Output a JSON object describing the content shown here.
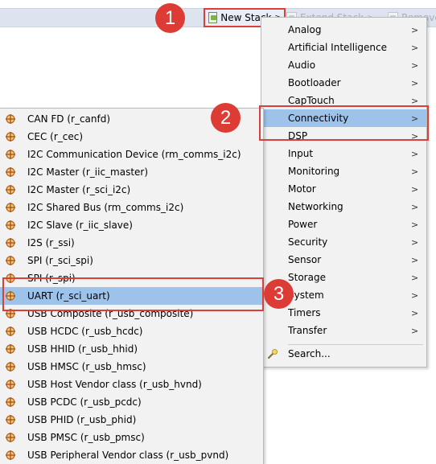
{
  "toolbar": {
    "new_stack_label": "New Stack",
    "new_stack_caret": ">",
    "extend_stack_label": "Extend Stack",
    "extend_stack_caret": ">",
    "remove_label": "Remove"
  },
  "badges": {
    "step1": "1",
    "step2": "2",
    "step3": "3"
  },
  "categories": {
    "items": [
      {
        "label": "Analog",
        "arrow": ">"
      },
      {
        "label": "Artificial Intelligence",
        "arrow": ">"
      },
      {
        "label": "Audio",
        "arrow": ">"
      },
      {
        "label": "Bootloader",
        "arrow": ">"
      },
      {
        "label": "CapTouch",
        "arrow": ">"
      },
      {
        "label": "Connectivity",
        "arrow": ">"
      },
      {
        "label": "DSP",
        "arrow": ">"
      },
      {
        "label": "Input",
        "arrow": ">"
      },
      {
        "label": "Monitoring",
        "arrow": ">"
      },
      {
        "label": "Motor",
        "arrow": ">"
      },
      {
        "label": "Networking",
        "arrow": ">"
      },
      {
        "label": "Power",
        "arrow": ">"
      },
      {
        "label": "Security",
        "arrow": ">"
      },
      {
        "label": "Sensor",
        "arrow": ">"
      },
      {
        "label": "Storage",
        "arrow": ">"
      },
      {
        "label": "System",
        "arrow": ">"
      },
      {
        "label": "Timers",
        "arrow": ">"
      },
      {
        "label": "Transfer",
        "arrow": ">"
      }
    ],
    "selected": "Connectivity",
    "search_label": "Search..."
  },
  "components": {
    "items": [
      "CAN FD (r_canfd)",
      "CEC (r_cec)",
      "I2C Communication Device (rm_comms_i2c)",
      "I2C Master (r_iic_master)",
      "I2C Master (r_sci_i2c)",
      "I2C Shared Bus (rm_comms_i2c)",
      "I2C Slave (r_iic_slave)",
      "I2S (r_ssi)",
      "SPI (r_sci_spi)",
      "SPI (r_spi)",
      "UART (r_sci_uart)",
      "USB Composite (r_usb_composite)",
      "USB HCDC (r_usb_hcdc)",
      "USB HHID (r_usb_hhid)",
      "USB HMSC (r_usb_hmsc)",
      "USB Host Vendor class (r_usb_hvnd)",
      "USB PCDC (r_usb_pcdc)",
      "USB PHID (r_usb_phid)",
      "USB PMSC (r_usb_pmsc)",
      "USB Peripheral Vendor class (r_usb_pvnd)"
    ],
    "selected": "UART (r_sci_uart)",
    "icon": "component-icon"
  },
  "colors": {
    "selection": "#9ec3ea",
    "highlight_box": "#d9403a",
    "badge": "#dd3b35",
    "menu_bg": "#f2f2f2"
  }
}
